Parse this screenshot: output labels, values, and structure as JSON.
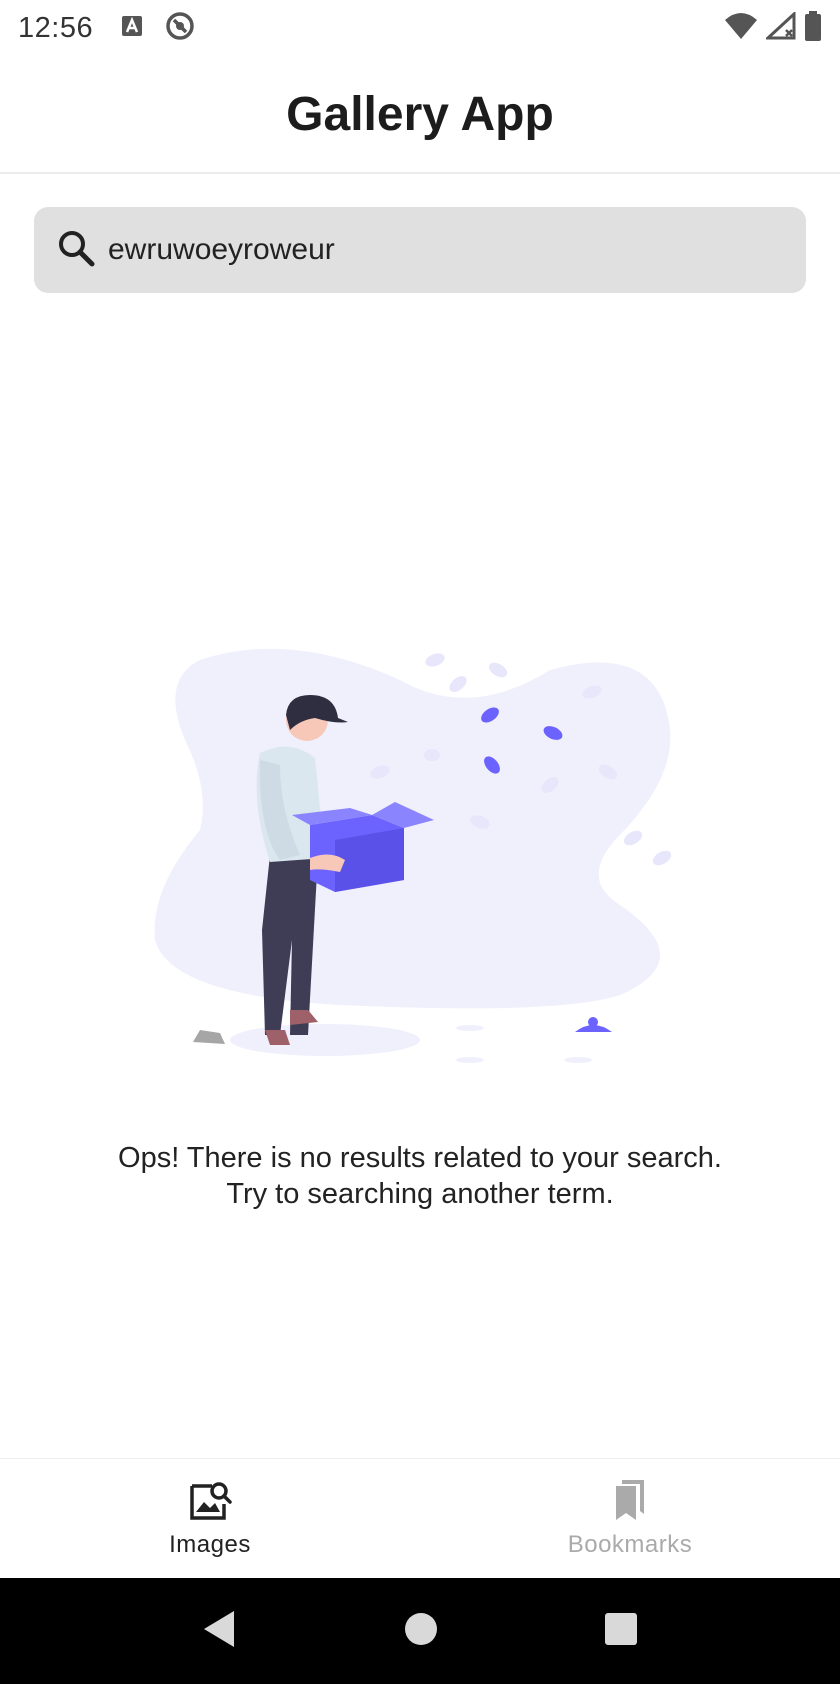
{
  "status_bar": {
    "time": "12:56",
    "left_icons": [
      "a-notification-icon",
      "sync-circle-icon"
    ],
    "right_icons": [
      "wifi-icon",
      "signal-icon",
      "battery-icon"
    ]
  },
  "app_bar": {
    "title": "Gallery App"
  },
  "search": {
    "value": "ewruwoeyroweur",
    "icon": "search-icon"
  },
  "empty_state": {
    "line1": "Ops! There is no results related to your search.",
    "line2": "Try to searching another term."
  },
  "bottom_nav": {
    "items": [
      {
        "label": "Images",
        "icon": "image-search-icon",
        "active": true
      },
      {
        "label": "Bookmarks",
        "icon": "bookmarks-icon",
        "active": false
      }
    ]
  },
  "system_nav": {
    "buttons": [
      "back-icon",
      "home-icon",
      "recents-icon"
    ]
  },
  "colors": {
    "accent": "#6c63ff",
    "blob": "#f0effc",
    "search_bg": "#e0e0e0",
    "inactive": "#aaaaaa"
  }
}
